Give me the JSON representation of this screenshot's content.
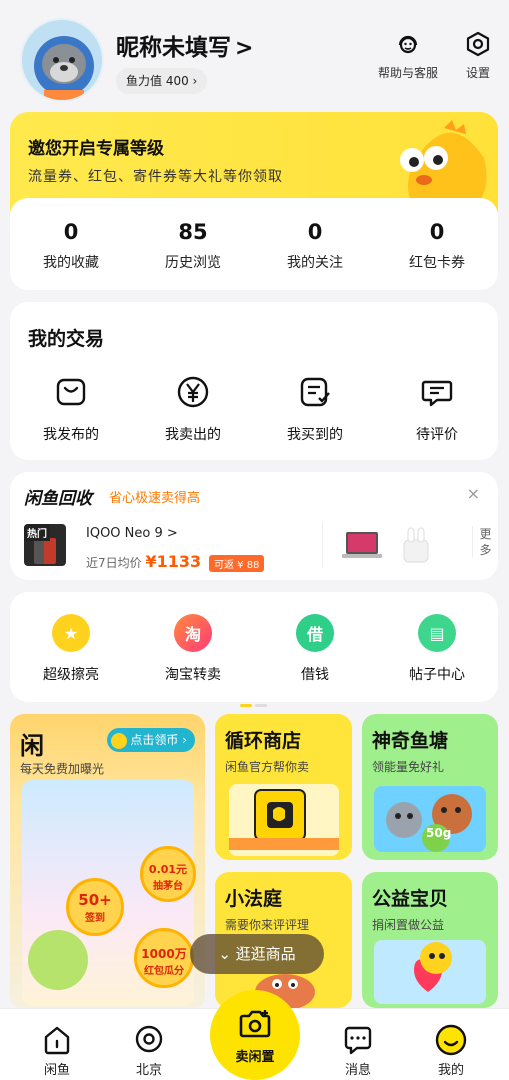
{
  "profile": {
    "nickname": "昵称未填写",
    "nickname_chevron": ">",
    "fish_power": "鱼力值 400 ›",
    "help_label": "帮助与客服",
    "settings_label": "设置"
  },
  "level_card": {
    "title": "邀您开启专属等级",
    "subtitle": "流量券、红包、寄件券等大礼等你领取"
  },
  "stats": [
    {
      "num": "0",
      "label": "我的收藏"
    },
    {
      "num": "85",
      "label": "历史浏览"
    },
    {
      "num": "0",
      "label": "我的关注"
    },
    {
      "num": "0",
      "label": "红包卡券"
    }
  ],
  "trade": {
    "title": "我的交易",
    "items": [
      {
        "label": "我发布的",
        "icon": "bag-icon"
      },
      {
        "label": "我卖出的",
        "icon": "yen-icon"
      },
      {
        "label": "我买到的",
        "icon": "order-check-icon"
      },
      {
        "label": "待评价",
        "icon": "comment-icon"
      }
    ]
  },
  "recycle": {
    "title": "闲鱼回收",
    "subtitle": "省心极速卖得高",
    "close": "×",
    "hot_tag": "热门",
    "phone_name": "IQOO Neo 9 >",
    "avg_prefix": "近7日均价",
    "price": "¥1133",
    "refund": "可返 ¥ 88",
    "more": "更多"
  },
  "shortcuts": [
    {
      "label": "超级擦亮",
      "icon": "star-icon",
      "color": "#ffd21e",
      "glyph": "★"
    },
    {
      "label": "淘宝转卖",
      "icon": "taobao-icon",
      "color": "#ff4a6e",
      "glyph": "淘"
    },
    {
      "label": "借钱",
      "icon": "loan-icon",
      "color": "#2fcf89",
      "glyph": "借"
    },
    {
      "label": "帖子中心",
      "icon": "post-icon",
      "color": "#3dd68c",
      "glyph": "▤"
    }
  ],
  "promo": {
    "xianyu_title": "闲",
    "xianyu_sub": "每天免费加曝光",
    "coin_btn": "点击领币 ›",
    "badge_50": "50+",
    "badge_50_sub": "签到",
    "badge_001": "0.01元",
    "badge_001_sub": "抽茅台",
    "badge_1000": "1000万",
    "badge_1000_sub": "红包瓜分",
    "store_title": "循环商店",
    "store_sub": "闲鱼官方帮你卖",
    "pond_title": "神奇鱼塘",
    "pond_sub": "领能量免好礼",
    "pond_badge": "50g",
    "court_title": "小法庭",
    "court_sub": "需要你来评评理",
    "charity_title": "公益宝贝",
    "charity_sub": "捐闲置做公益",
    "browse": "⌄ 逛逛商品"
  },
  "tabbar": {
    "home": "闲鱼",
    "location": "北京",
    "sell": "卖闲置",
    "messages": "消息",
    "mine": "我的"
  },
  "colors": {
    "brand_yellow": "#ffe300",
    "price_orange": "#ff5a00"
  }
}
